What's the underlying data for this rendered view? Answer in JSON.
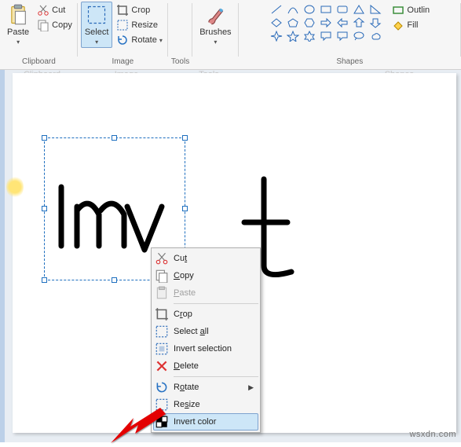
{
  "ribbon": {
    "groups": {
      "clipboard": {
        "label": "Clipboard",
        "paste": "Paste",
        "cut": "Cut",
        "copy": "Copy"
      },
      "image": {
        "label": "Image",
        "select": "Select",
        "crop": "Crop",
        "resize": "Resize",
        "rotate": "Rotate"
      },
      "tools": {
        "label": "Tools"
      },
      "brushes": {
        "label": "Brushes"
      },
      "shapes": {
        "label": "Shapes",
        "outline": "Outlin",
        "fill": "Fill"
      }
    }
  },
  "faded": {
    "clipboard": "Clipboard",
    "image": "Image",
    "tools": "Tools",
    "shapes": "Shapes"
  },
  "context_menu": {
    "cut": "Cut",
    "copy": "Copy",
    "paste": "Paste",
    "crop": "Crop",
    "select_all": "Select all",
    "invert_selection": "Invert selection",
    "delete": "Delete",
    "rotate": "Rotate",
    "resize": "Resize",
    "invert_color": "Invert color"
  },
  "watermark": "wsxdn.com",
  "colors": {
    "accent": "#cde6f7",
    "accent_border": "#7da2ce",
    "selection": "#1e6fbf",
    "arrow": "#e30000"
  }
}
